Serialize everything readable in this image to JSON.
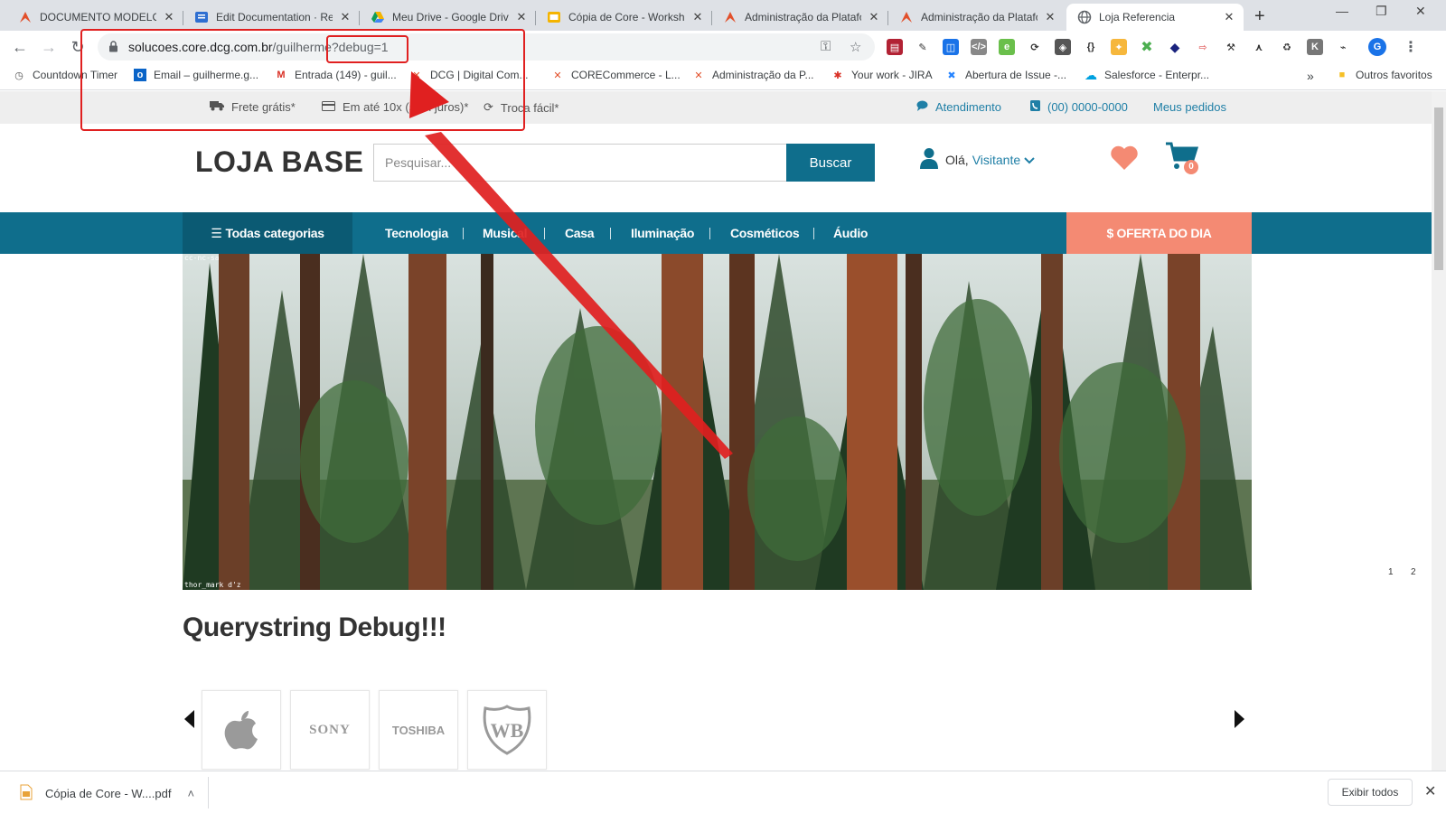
{
  "browser": {
    "tabs": [
      {
        "title": "DOCUMENTO MODELO",
        "icon": "core-logo-icon"
      },
      {
        "title": "Edit Documentation · Re",
        "icon": "doc-icon"
      },
      {
        "title": "Meu Drive - Google Driv",
        "icon": "google-drive-icon"
      },
      {
        "title": "Cópia de Core - Worksho",
        "icon": "slides-icon"
      },
      {
        "title": "Administração da Platafo",
        "icon": "core-logo-icon"
      },
      {
        "title": "Administração da Platafo",
        "icon": "core-logo-icon"
      },
      {
        "title": "Loja Referencia",
        "icon": "globe-icon",
        "active": true
      }
    ],
    "url_host": "solucoes.core.dcg.com.br",
    "url_path": "/guilherme?debug=1",
    "bookmarks": [
      {
        "label": "Countdown Timer",
        "icon": "timer-icon"
      },
      {
        "label": "Email – guilherme.g...",
        "icon": "outlook-icon"
      },
      {
        "label": "Entrada (149) - guil...",
        "icon": "gmail-icon"
      },
      {
        "label": "DCG | Digital Com...",
        "icon": "core-logo-icon"
      },
      {
        "label": "CORECommerce - L...",
        "icon": "core-logo-icon"
      },
      {
        "label": "Administração da P...",
        "icon": "core-logo-icon"
      },
      {
        "label": "Your work - JIRA",
        "icon": "jira-icon"
      },
      {
        "label": "Abertura de Issue -...",
        "icon": "jira-icon"
      },
      {
        "label": "Salesforce - Enterpr...",
        "icon": "salesforce-icon"
      }
    ],
    "bookmarks_more": "»",
    "other_bookmarks": "Outros favoritos",
    "profile_initial": "G"
  },
  "store": {
    "topbar": {
      "free_shipping": "Frete grátis*",
      "installments": "Em até 10x (sem juros)*",
      "easy_exchange": "Troca fácil*",
      "support": "Atendimento",
      "phone": "(00) 0000-0000",
      "orders": "Meus pedidos"
    },
    "logo": "LOJA BASE",
    "search": {
      "placeholder": "Pesquisar...",
      "button": "Buscar"
    },
    "user": {
      "greeting": "Olá,",
      "name": "Visitante"
    },
    "cart_count": "0",
    "nav": {
      "all_categories": "Todas categorias",
      "categories": [
        "Tecnologia",
        "Musical",
        "Casa",
        "Iluminação",
        "Cosméticos",
        "Áudio"
      ],
      "deal": "$ OFERTA DO DIA"
    },
    "banner": {
      "credit_top": "cc-nc-sa",
      "credit_bottom": "thor_mark d'z"
    },
    "slider_dots": [
      "1",
      "2"
    ],
    "section_title": "Querystring Debug!!!",
    "brands": [
      "Apple",
      "SONY",
      "TOSHIBA",
      "WB"
    ]
  },
  "downloads": {
    "file": "Cópia de Core - W....pdf",
    "show_all": "Exibir todos"
  },
  "colors": {
    "primary": "#0f6e8c",
    "accent": "#f48a73",
    "annotation": "#e02020"
  }
}
